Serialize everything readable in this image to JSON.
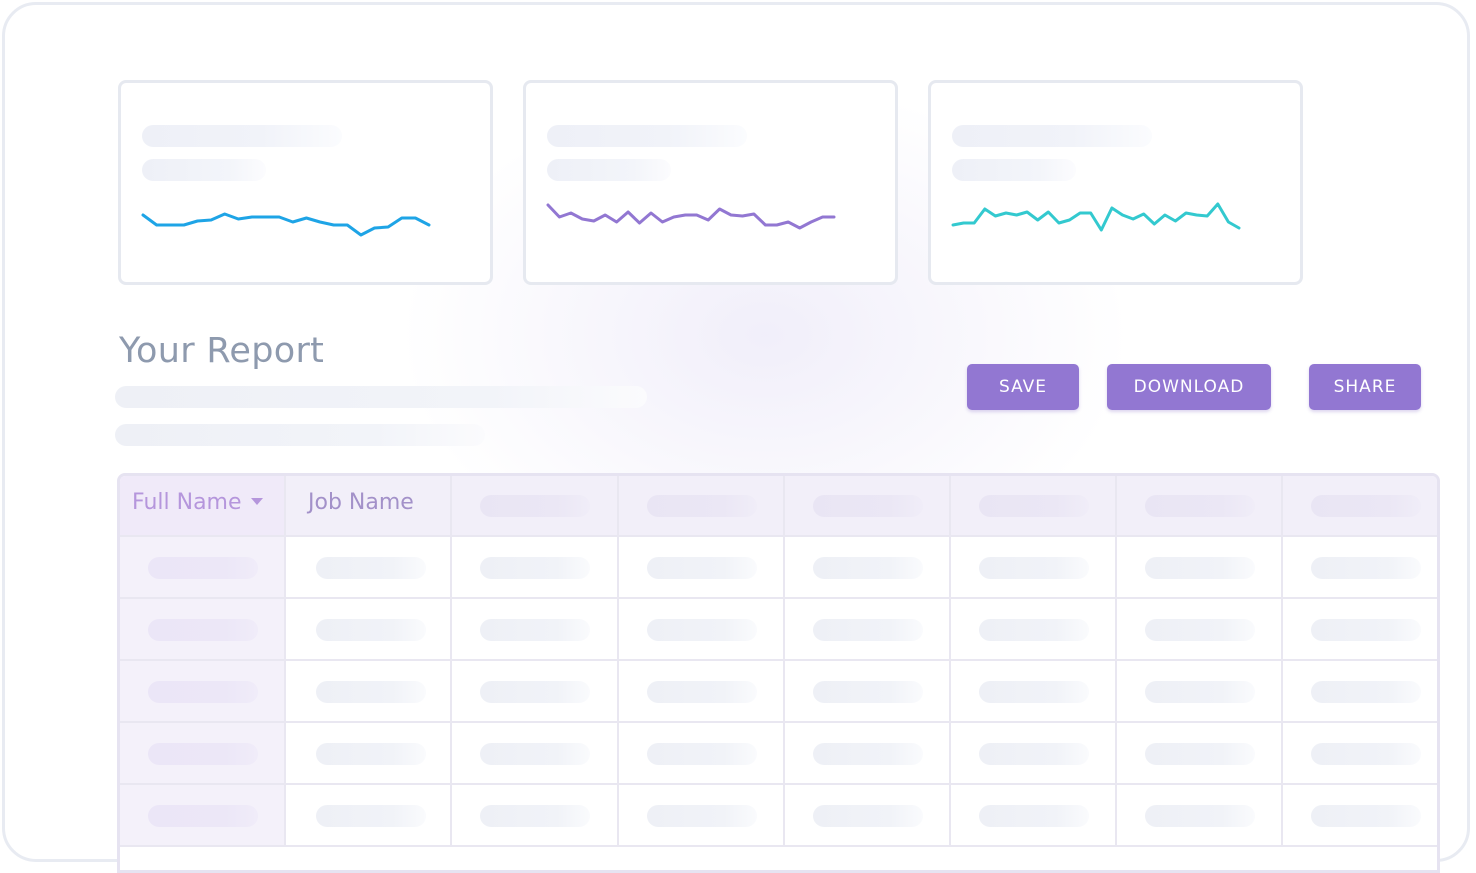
{
  "cards": [
    {
      "name": "card-1",
      "color": "#1ea4e6",
      "sparkline": [
        10,
        0,
        0,
        0,
        4,
        5,
        11,
        6,
        8,
        8,
        8,
        3,
        7,
        3,
        0,
        0,
        -10,
        -3,
        -2,
        7,
        7,
        0
      ]
    },
    {
      "name": "card-2",
      "color": "#9277d2",
      "sparkline": [
        20,
        8,
        12,
        6,
        4,
        10,
        3,
        13,
        2,
        12,
        3,
        8,
        10,
        10,
        5,
        16,
        10,
        9,
        11,
        0,
        0,
        3,
        -3,
        3,
        8,
        8
      ]
    },
    {
      "name": "card-3",
      "color": "#33c9cf",
      "sparkline": [
        0,
        2,
        2,
        16,
        9,
        12,
        10,
        13,
        5,
        13,
        2,
        5,
        12,
        12,
        -5,
        17,
        10,
        6,
        11,
        1,
        10,
        4,
        12,
        10,
        9,
        21,
        3,
        -3
      ]
    }
  ],
  "report": {
    "title": "Your Report"
  },
  "actions": {
    "save": "SAVE",
    "download": "DOWNLOAD",
    "share": "SHARE"
  },
  "table": {
    "headers": [
      "Full Name",
      "Job Name"
    ]
  }
}
